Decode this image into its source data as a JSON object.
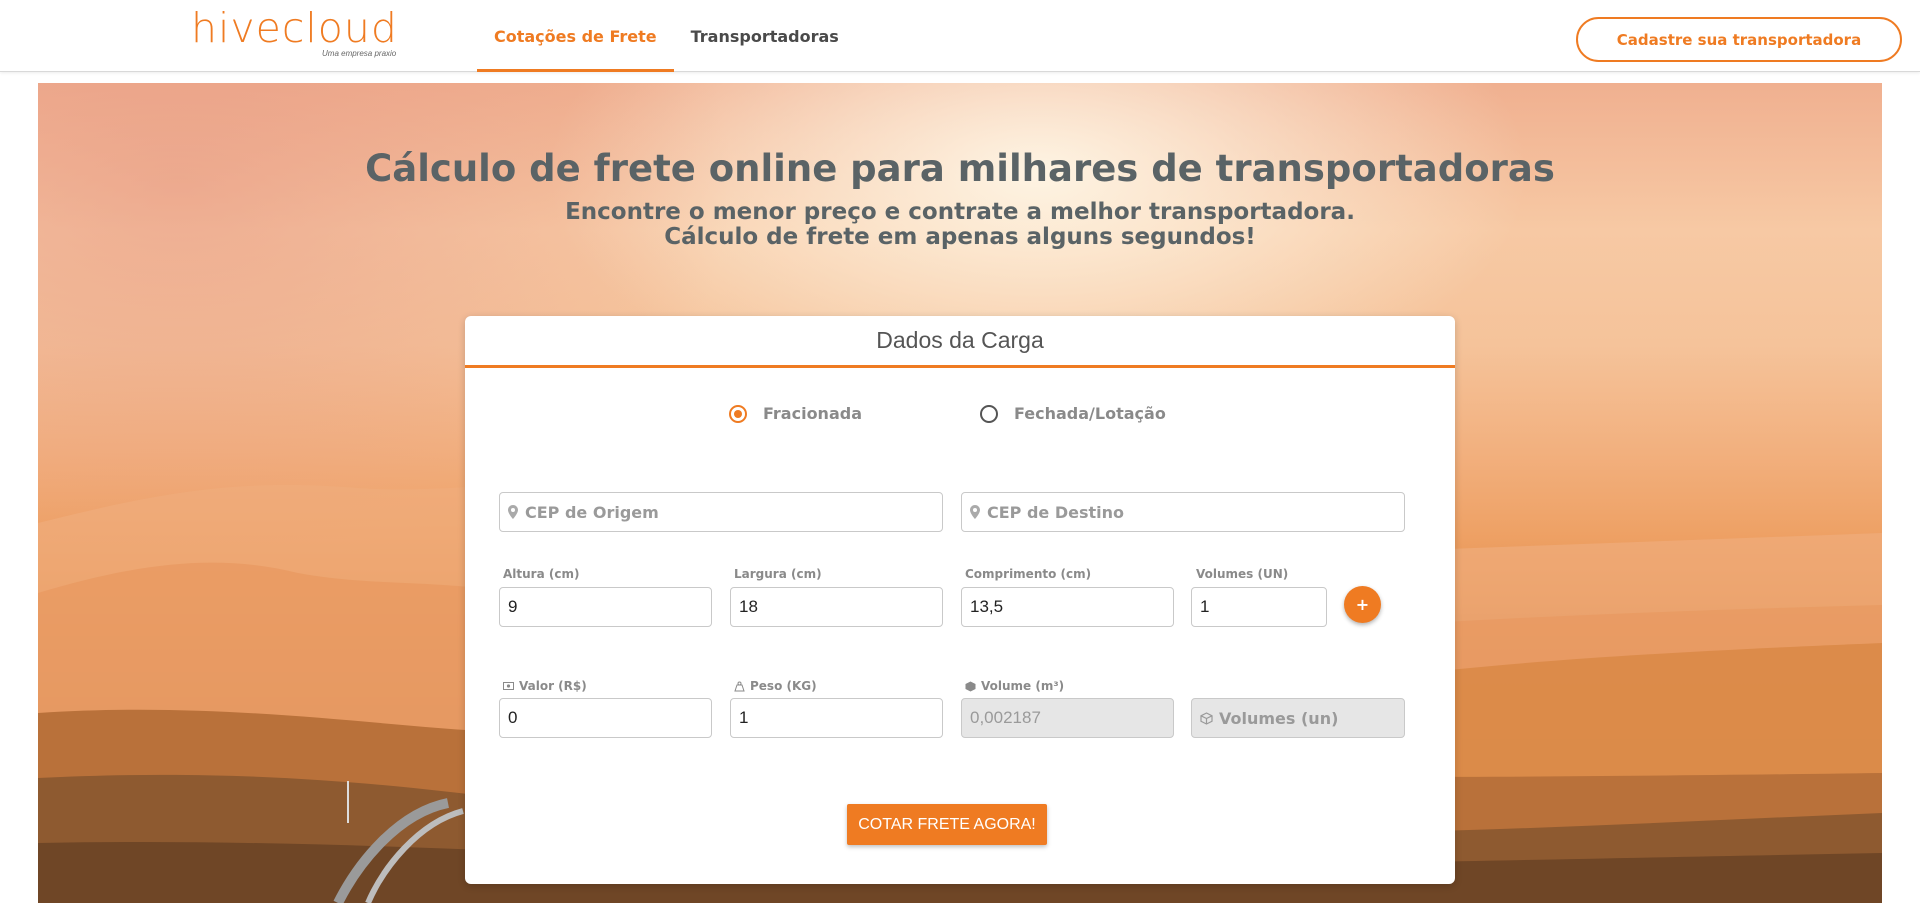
{
  "brand": {
    "logo_text": "hivecloud",
    "tagline": "Uma empresa praxio",
    "accent_color": "#ef7b22"
  },
  "nav": {
    "items": [
      {
        "label": "Cotações de Frete",
        "active": true
      },
      {
        "label": "Transportadoras",
        "active": false
      }
    ],
    "cta_label": "Cadastre sua transportadora"
  },
  "hero": {
    "title": "Cálculo de frete online para milhares de transportadoras",
    "subtitle_line1": "Encontre o menor preço e contrate a melhor transportadora.",
    "subtitle_line2": "Cálculo de frete em apenas alguns segundos!"
  },
  "form": {
    "title": "Dados da Carga",
    "load_types": [
      {
        "label": "Fracionada",
        "checked": true
      },
      {
        "label": "Fechada/Lotação",
        "checked": false
      }
    ],
    "cep_origem": {
      "placeholder": "CEP de Origem",
      "icon": "map-pin-icon"
    },
    "cep_destino": {
      "placeholder": "CEP de Destino",
      "icon": "map-pin-icon"
    },
    "altura": {
      "label": "Altura (cm)",
      "value": "9"
    },
    "largura": {
      "label": "Largura (cm)",
      "value": "18"
    },
    "comprimento": {
      "label": "Comprimento (cm)",
      "value": "13,5"
    },
    "volumes": {
      "label": "Volumes (UN)",
      "value": "1"
    },
    "add_button": "+",
    "valor": {
      "label": "Valor (R$)",
      "value": "0",
      "icon": "money-icon"
    },
    "peso": {
      "label": "Peso (KG)",
      "value": "1",
      "icon": "weight-icon"
    },
    "volume_m3": {
      "label": "Volume (m³)",
      "value": "0,002187",
      "icon": "cube-icon"
    },
    "volumes_un": {
      "placeholder": "Volumes (un)",
      "icon": "box-icon"
    },
    "submit_label": "COTAR FRETE AGORA!"
  }
}
